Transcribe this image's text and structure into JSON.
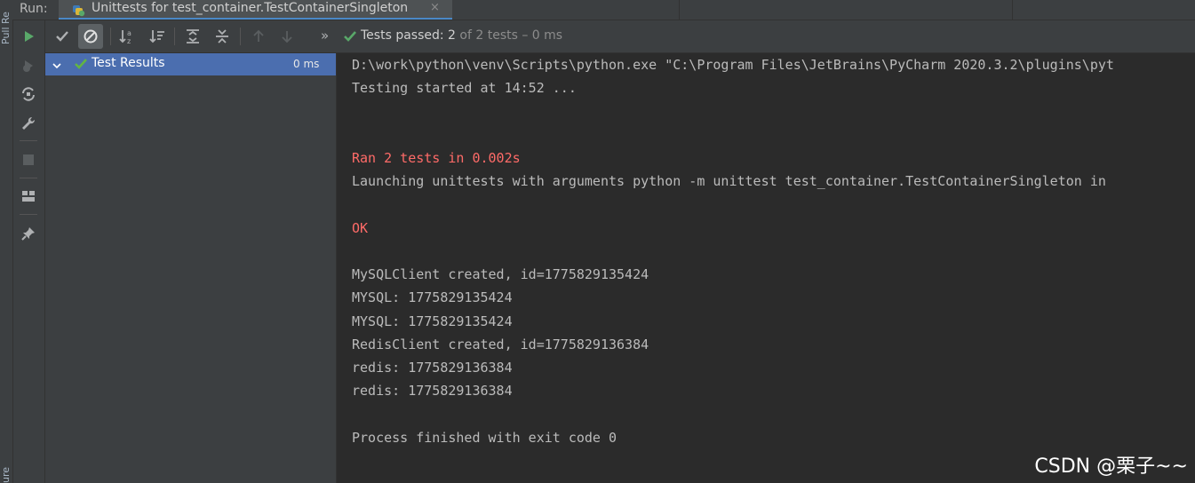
{
  "side_strip": {
    "top_label": "Pull Re",
    "bottom_label": "ure"
  },
  "tab_bar": {
    "run_label": "Run:",
    "tab_title": "Unittests for test_container.TestContainerSingleton",
    "close_glyph": "×"
  },
  "toolbar": {
    "status_prefix": "Tests passed:",
    "status_count": "2",
    "status_suffix": "of 2 tests – 0 ms",
    "expand_glyph": "»"
  },
  "tree": {
    "root_label": "Test Results",
    "root_time": "0 ms"
  },
  "console": {
    "lines": [
      "D:\\work\\python\\venv\\Scripts\\python.exe \"C:\\Program Files\\JetBrains\\PyCharm 2020.3.2\\plugins\\pyt",
      "Testing started at 14:52 ...",
      "Ran 2 tests in 0.002s",
      "Launching unittests with arguments python -m unittest test_container.TestContainerSingleton in",
      "OK",
      "MySQLClient created, id=1775829135424",
      "MYSQL: 1775829135424",
      "MYSQL: 1775829135424",
      "RedisClient created, id=1775829136384",
      "redis: 1775829136384",
      "redis: 1775829136384",
      "Process finished with exit code 0"
    ]
  },
  "watermark": "CSDN @栗子~~",
  "colors": {
    "accent": "#4a88c7",
    "pass_green": "#59a869",
    "error_red": "#ff6b68",
    "selection": "#4b6eaf"
  }
}
